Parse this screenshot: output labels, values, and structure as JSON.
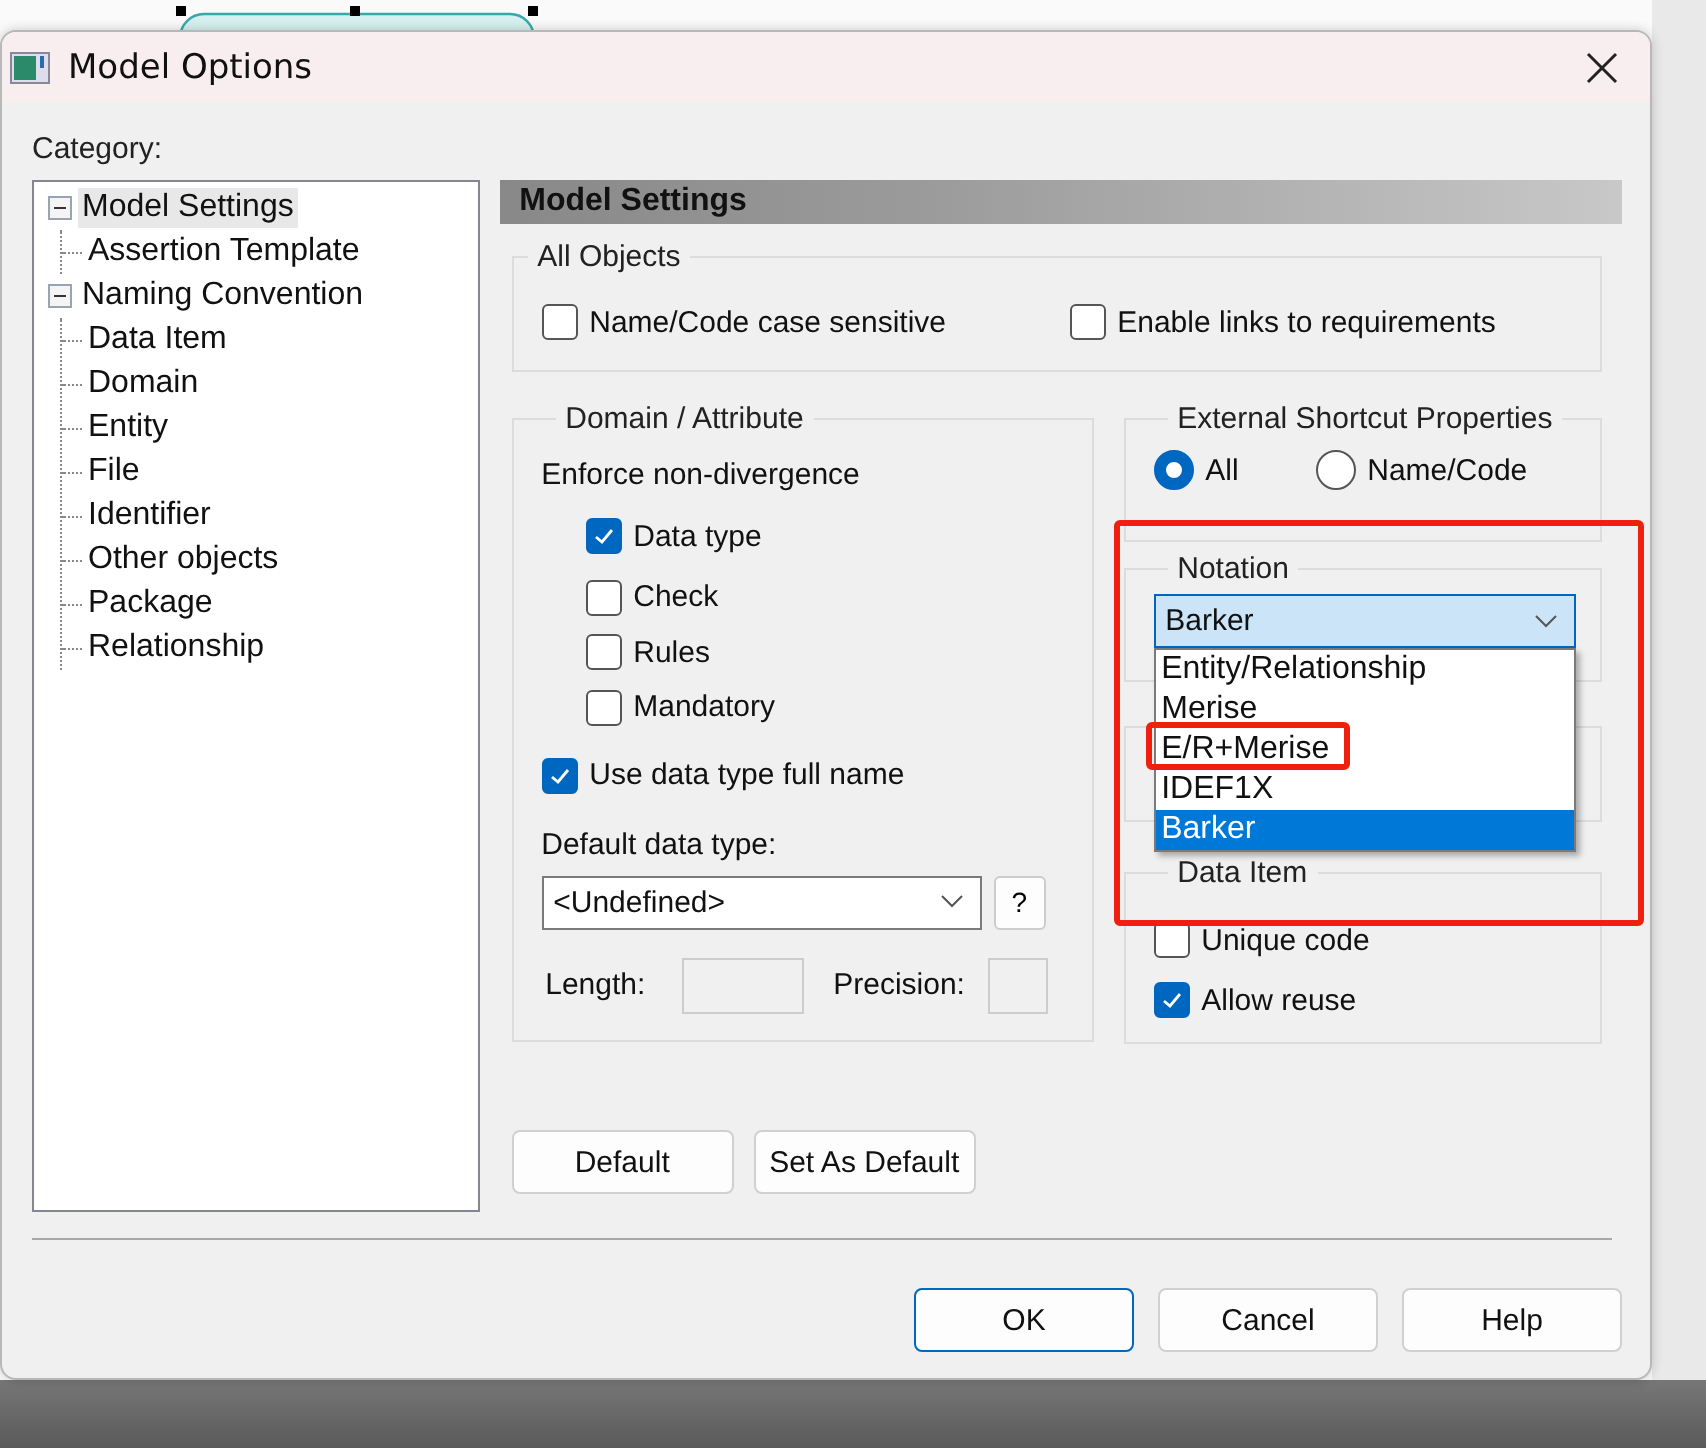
{
  "window": {
    "title": "Model Options"
  },
  "category_label": "Category:",
  "tree": [
    {
      "label": "Model Settings",
      "expanded": true,
      "selected": true,
      "children": [
        {
          "label": "Assertion Template",
          "selected": false
        }
      ]
    },
    {
      "label": "Naming Convention",
      "expanded": true,
      "selected": false,
      "children": [
        {
          "label": "Data Item",
          "selected": false
        },
        {
          "label": "Domain",
          "selected": false
        },
        {
          "label": "Entity",
          "selected": false
        },
        {
          "label": "File",
          "selected": false
        },
        {
          "label": "Identifier",
          "selected": false
        },
        {
          "label": "Other objects",
          "selected": false
        },
        {
          "label": "Package",
          "selected": false
        },
        {
          "label": "Relationship",
          "selected": false
        }
      ]
    }
  ],
  "panel": {
    "title": "Model Settings",
    "all_objects": {
      "title": "All Objects",
      "options": [
        {
          "label": "Name/Code case sensitive",
          "checked": false
        },
        {
          "label": "Enable links to requirements",
          "checked": false
        }
      ]
    },
    "domain_attribute": {
      "title": "Domain / Attribute",
      "enforce_label": "Enforce non-divergence",
      "enforce_options": [
        {
          "label": "Data type",
          "checked": true
        },
        {
          "label": "Check",
          "checked": false
        },
        {
          "label": "Rules",
          "checked": false
        },
        {
          "label": "Mandatory",
          "checked": false
        }
      ],
      "full_name": {
        "label": "Use data type full name",
        "checked": true
      },
      "default_type_label": "Default data type:",
      "default_type": "<Undefined>",
      "help_button": "?",
      "length_label": "Length:",
      "precision_label": "Precision:"
    },
    "external_shortcut": {
      "title": "External Shortcut Properties",
      "options": [
        {
          "label": "All",
          "selected": true
        },
        {
          "label": "Name/Code",
          "selected": false
        }
      ]
    },
    "notation": {
      "title": "Notation",
      "value": "Barker",
      "expanded": true,
      "options": [
        {
          "label": "Entity/Relationship",
          "selected": false
        },
        {
          "label": "Merise",
          "selected": false
        },
        {
          "label": "E/R+Merise",
          "selected": false
        },
        {
          "label": "IDEF1X",
          "selected": false
        },
        {
          "label": "Barker",
          "selected": true
        }
      ]
    },
    "data_item": {
      "title": "Data Item",
      "options": [
        {
          "label": "Unique code",
          "checked": false
        },
        {
          "label": "Allow reuse",
          "checked": true
        }
      ]
    },
    "buttons": [
      "Default",
      "Set As Default"
    ]
  },
  "dialog_buttons": [
    {
      "label": "OK",
      "default": true
    },
    {
      "label": "Cancel",
      "default": false
    },
    {
      "label": "Help",
      "default": false
    }
  ]
}
